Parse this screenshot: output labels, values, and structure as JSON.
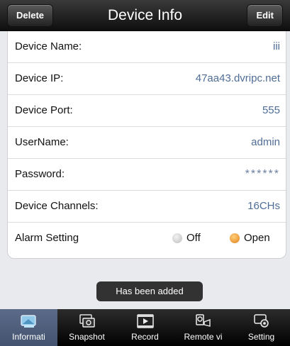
{
  "header": {
    "title": "Device Info",
    "delete_label": "Delete",
    "edit_label": "Edit"
  },
  "fields": [
    {
      "label": "Device Name:",
      "value": "iii"
    },
    {
      "label": "Device IP:",
      "value": "47aa43.dvripc.net"
    },
    {
      "label": "Device Port:",
      "value": "555"
    },
    {
      "label": "UserName:",
      "value": "admin"
    },
    {
      "label": "Password:",
      "value": "******"
    },
    {
      "label": "Device Channels:",
      "value": "16CHs"
    }
  ],
  "alarm": {
    "label": "Alarm Setting",
    "off_label": "Off",
    "open_label": "Open",
    "selected": "Open"
  },
  "toast": {
    "message": "Has been added"
  },
  "tabs": [
    {
      "label": "Informati",
      "icon": "information-icon",
      "active": true
    },
    {
      "label": "Snapshot",
      "icon": "snapshot-icon",
      "active": false
    },
    {
      "label": "Record",
      "icon": "record-icon",
      "active": false
    },
    {
      "label": "Remote vi",
      "icon": "remote-view-icon",
      "active": false
    },
    {
      "label": "Setting",
      "icon": "setting-icon",
      "active": false
    }
  ],
  "colors": {
    "value_text": "#4f6d95",
    "radio_selected": "#e0801b",
    "active_tab": "#4d5d7c"
  }
}
